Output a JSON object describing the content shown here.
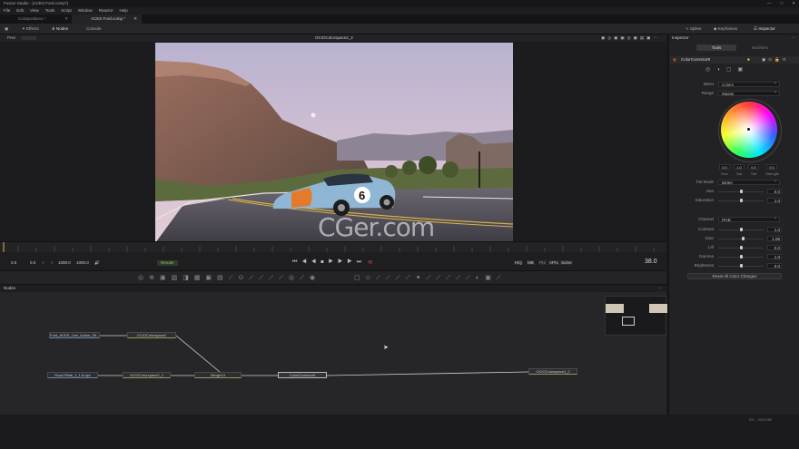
{
  "window": {
    "title": "Fusion Studio - [ACES Ford.comp*]",
    "controls": [
      "—",
      "□",
      "✕"
    ]
  },
  "menu": [
    "File",
    "Edit",
    "View",
    "Tools",
    "Script",
    "Window",
    "Reactor",
    "Help"
  ],
  "tabs": [
    {
      "label": "Composition1 *",
      "active": false
    },
    {
      "label": "ACES Ford.comp *",
      "active": true
    }
  ],
  "toolbar": {
    "effects": "Effects",
    "nodes": "Nodes",
    "console": "Console",
    "spline": "Spline",
    "keyframes": "Keyframes",
    "inspector": "Inspector"
  },
  "viewer": {
    "title": "OCIOColorspace2_2",
    "prev_label": "Prev"
  },
  "transport": {
    "start": "0.0",
    "start2": "0.0",
    "end": "1000.0",
    "end2": "1000.0",
    "render": "Render",
    "current_frame": "38.0",
    "modes": [
      "HiQ",
      "MB",
      "Prx",
      "APrx",
      "Some"
    ]
  },
  "nodes_panel": {
    "label": "Nodes",
    "items": {
      "loader1": "Ford_ACES_Live_Action_06...",
      "loader2": "Road Plate_1_1.8.dpx",
      "ocio2": "OCIOColorspace2",
      "ocio1": "OCIOColorspace2_1",
      "merge": "Merge13",
      "cc": "ColorCorrector9",
      "ocio22": "OCIOColorspace2_2"
    }
  },
  "inspector": {
    "header": "Inspector",
    "tab_tools": "Tools",
    "tab_modifiers": "Modifiers",
    "node_name": "ColorCorrector9",
    "menu_label": "Menu",
    "menu_value": "Colors",
    "range_label": "Range",
    "range_value": "Master",
    "hue": "0.0",
    "sat": "1.0",
    "tint": "0.0",
    "strength": "0.0",
    "hue_lbl": "Hue",
    "sat_lbl": "Sat",
    "tint_lbl": "Tint",
    "strength_lbl": "Strength",
    "tint_mode_label": "Tint Mode",
    "tint_mode_value": "Better",
    "hue_label": "Hue",
    "hue_value": "0.0",
    "saturation_label": "Saturation",
    "saturation_value": "1.0",
    "channel_label": "Channel",
    "channel_value": "RGB",
    "contrast_label": "Contrast",
    "contrast_value": "1.0",
    "gain_label": "Gain",
    "gain_value": "1.06",
    "lift_label": "Lift",
    "lift_value": "0.0",
    "gamma_label": "Gamma",
    "gamma_value": "1.0",
    "brightness_label": "Brightness",
    "brightness_value": "0.0",
    "reset": "Reset All Color Changes"
  },
  "watermark": "CGer.com",
  "status": "3% - 1933 MB"
}
